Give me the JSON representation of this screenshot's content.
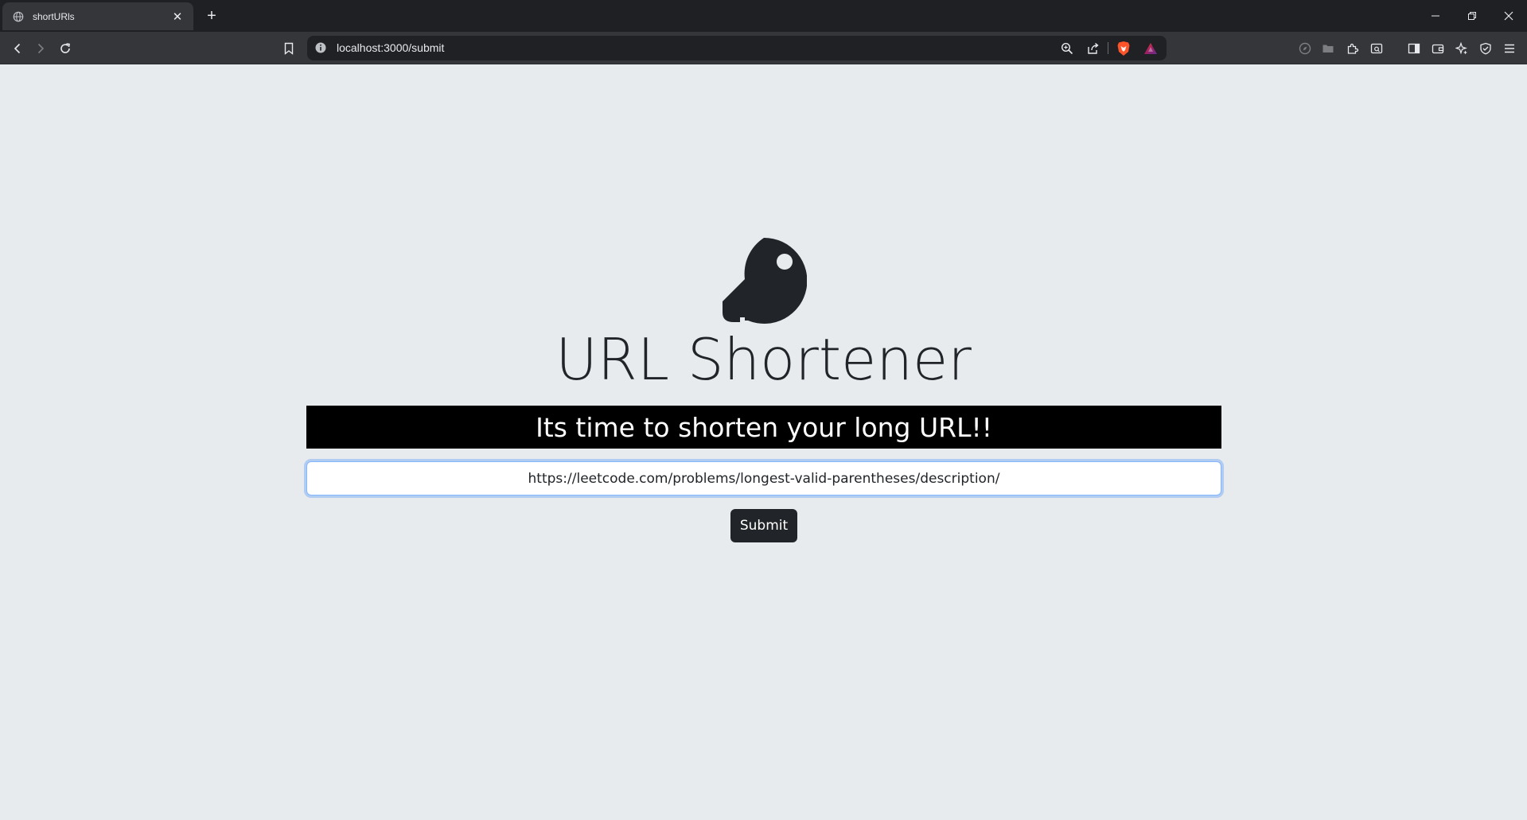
{
  "browser": {
    "tab": {
      "title": "shortURls",
      "close_label": "✕"
    },
    "new_tab_label": "+",
    "address": {
      "url": "localhost:3000/submit"
    }
  },
  "page": {
    "logo_icon": "key-icon",
    "title": "URL Shortener",
    "banner": "Its time to shorten your long URL!!",
    "url_input": {
      "value": "https://leetcode.com/problems/longest-valid-parentheses/description/"
    },
    "submit_label": "Submit"
  },
  "colors": {
    "page_background": "#e8ebee",
    "title_text": "#212529",
    "banner_background": "#000000",
    "button_background": "#212529",
    "input_focus_border": "#86b7fe",
    "brave_orange": "#fb542b"
  }
}
